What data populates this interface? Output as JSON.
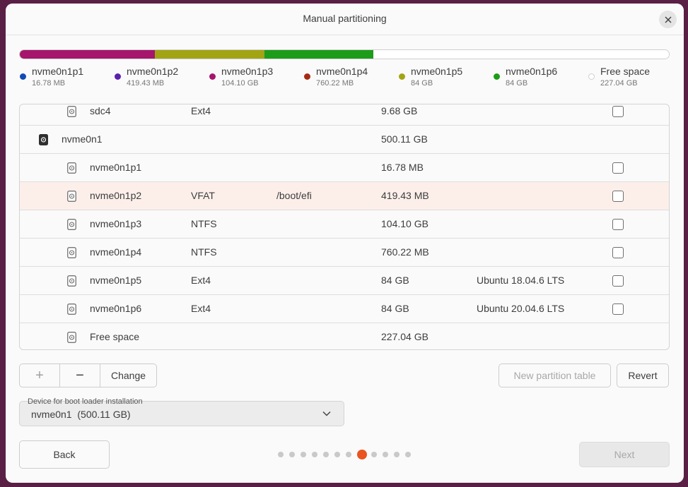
{
  "window": {
    "title": "Manual partitioning"
  },
  "usage_bar": [
    {
      "color": "#a5166c",
      "fraction": 0.208
    },
    {
      "color": "#a2a414",
      "fraction": 0.169
    },
    {
      "color": "#1c9c19",
      "fraction": 0.168
    },
    {
      "color": "#ffffff",
      "fraction": 0.455
    }
  ],
  "legend": [
    {
      "name": "nvme0n1p1",
      "size": "16.78 MB",
      "color": "#0e4bb5"
    },
    {
      "name": "nvme0n1p2",
      "size": "419.43 MB",
      "color": "#5b1fae"
    },
    {
      "name": "nvme0n1p3",
      "size": "104.10 GB",
      "color": "#a5166c"
    },
    {
      "name": "nvme0n1p4",
      "size": "760.22 MB",
      "color": "#a52a12"
    },
    {
      "name": "nvme0n1p5",
      "size": "84 GB",
      "color": "#a2a414"
    },
    {
      "name": "nvme0n1p6",
      "size": "84 GB",
      "color": "#1c9c19"
    },
    {
      "name": "Free space",
      "size": "227.04 GB",
      "color": "#ffffff"
    }
  ],
  "partitions": [
    {
      "name": "sdc4",
      "type": "Ext4",
      "mount": "",
      "size": "9.68 GB",
      "system": "",
      "checkbox": true
    },
    {
      "name": "nvme0n1",
      "type": "",
      "mount": "",
      "size": "500.11 GB",
      "system": "",
      "checkbox": false,
      "disk": true
    },
    {
      "name": "nvme0n1p1",
      "type": "",
      "mount": "",
      "size": "16.78 MB",
      "system": "",
      "checkbox": true
    },
    {
      "name": "nvme0n1p2",
      "type": "VFAT",
      "mount": "/boot/efi",
      "size": "419.43 MB",
      "system": "",
      "checkbox": true,
      "selected": true
    },
    {
      "name": "nvme0n1p3",
      "type": "NTFS",
      "mount": "",
      "size": "104.10 GB",
      "system": "",
      "checkbox": true
    },
    {
      "name": "nvme0n1p4",
      "type": "NTFS",
      "mount": "",
      "size": "760.22 MB",
      "system": "",
      "checkbox": true
    },
    {
      "name": "nvme0n1p5",
      "type": "Ext4",
      "mount": "",
      "size": "84 GB",
      "system": "Ubuntu 18.04.6 LTS",
      "checkbox": true
    },
    {
      "name": "nvme0n1p6",
      "type": "Ext4",
      "mount": "",
      "size": "84 GB",
      "system": "Ubuntu 20.04.6 LTS",
      "checkbox": true
    },
    {
      "name": "Free space",
      "type": "",
      "mount": "",
      "size": "227.04 GB",
      "system": "",
      "checkbox": false
    }
  ],
  "toolbar": {
    "add_label": "+",
    "remove_label": "−",
    "change_label": "Change",
    "new_table_label": "New partition table",
    "revert_label": "Revert"
  },
  "boot_loader": {
    "label": "Device for boot loader installation",
    "value": "nvme0n1  (500.11 GB)"
  },
  "navigation": {
    "back_label": "Back",
    "next_label": "Next",
    "steps_total": 12,
    "current_step": 8
  }
}
